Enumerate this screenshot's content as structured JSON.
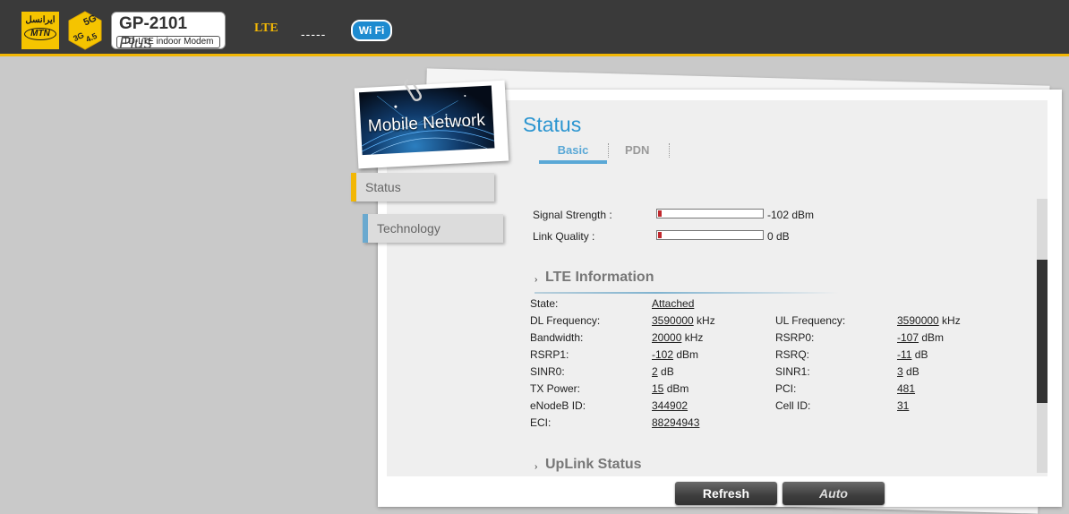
{
  "header": {
    "brand_fa": "ایرانسل",
    "brand_en": "MTN",
    "badge_5g": "5G",
    "badge_3g": "3G",
    "badge_45": "4.5",
    "model_name": "GP-2101",
    "model_suffix": "Plus",
    "model_sub": "TD-LTE indoor Modem",
    "network_type": "LTE",
    "network_signal": "-----",
    "wifi_label": "Wi Fi"
  },
  "section_card": {
    "title": "Mobile Network"
  },
  "sidebar": {
    "items": [
      {
        "label": "Status"
      },
      {
        "label": "Technology"
      }
    ]
  },
  "page": {
    "title": "Status",
    "tabs": [
      {
        "label": "Basic",
        "active": true
      },
      {
        "label": "PDN",
        "active": false
      }
    ]
  },
  "signal": {
    "strength_label": "Signal Strength :",
    "strength_value": "-102 dBm",
    "quality_label": "Link Quality :",
    "quality_value": "0 dB"
  },
  "lte": {
    "heading": "LTE Information",
    "state_label": "State:",
    "state_value": "Attached",
    "rows": [
      {
        "l1": "DL Frequency:",
        "v1": "3590000",
        "u1": " kHz",
        "l2": "UL Frequency:",
        "v2": "3590000",
        "u2": " kHz"
      },
      {
        "l1": "Bandwidth:",
        "v1": "20000",
        "u1": " kHz",
        "l2": "RSRP0:",
        "v2": "-107",
        "u2": " dBm"
      },
      {
        "l1": "RSRP1:",
        "v1": "-102",
        "u1": " dBm",
        "l2": "RSRQ:",
        "v2": "-11",
        "u2": " dB"
      },
      {
        "l1": "SINR0:",
        "v1": "2",
        "u1": " dB",
        "l2": "SINR1:",
        "v2": "3",
        "u2": " dB"
      },
      {
        "l1": "TX Power:",
        "v1": "15",
        "u1": " dBm",
        "l2": "PCI:",
        "v2": "481",
        "u2": ""
      },
      {
        "l1": "eNodeB ID:",
        "v1": "344902",
        "u1": "",
        "l2": "Cell ID:",
        "v2": "31",
        "u2": ""
      }
    ],
    "eci_label": "ECI:",
    "eci_value": "88294943"
  },
  "uplink": {
    "heading": "UpLink Status"
  },
  "buttons": {
    "refresh": "Refresh",
    "auto": "Auto"
  },
  "colors": {
    "accent": "#f2b705",
    "title": "#2b95d0",
    "tab_active": "#5aa8d6",
    "meter_fill": "#c0282d"
  }
}
